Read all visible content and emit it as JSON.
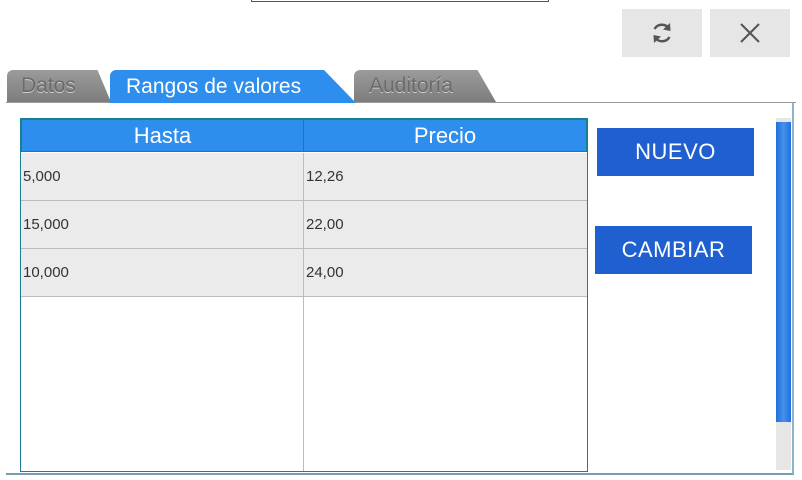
{
  "toolbar": {
    "refresh_icon": "refresh-icon",
    "close_icon": "close-icon"
  },
  "tabs": [
    {
      "label": "Datos",
      "active": false
    },
    {
      "label": "Rangos de valores",
      "active": true
    },
    {
      "label": "Auditoría",
      "active": false
    }
  ],
  "grid": {
    "columns": [
      "Hasta",
      "Precio"
    ],
    "rows": [
      {
        "hasta": "5,000",
        "precio": "12,26"
      },
      {
        "hasta": "15,000",
        "precio": "22,00"
      },
      {
        "hasta": "10,000",
        "precio": "24,00"
      }
    ]
  },
  "actions": {
    "nuevo_label": "NUEVO",
    "cambiar_label": "CAMBIAR"
  },
  "colors": {
    "tab_active": "#2d8eee",
    "header_bg": "#2d8eee",
    "button_bg": "#1f5fd0",
    "cell_bg": "#ebebeb"
  }
}
